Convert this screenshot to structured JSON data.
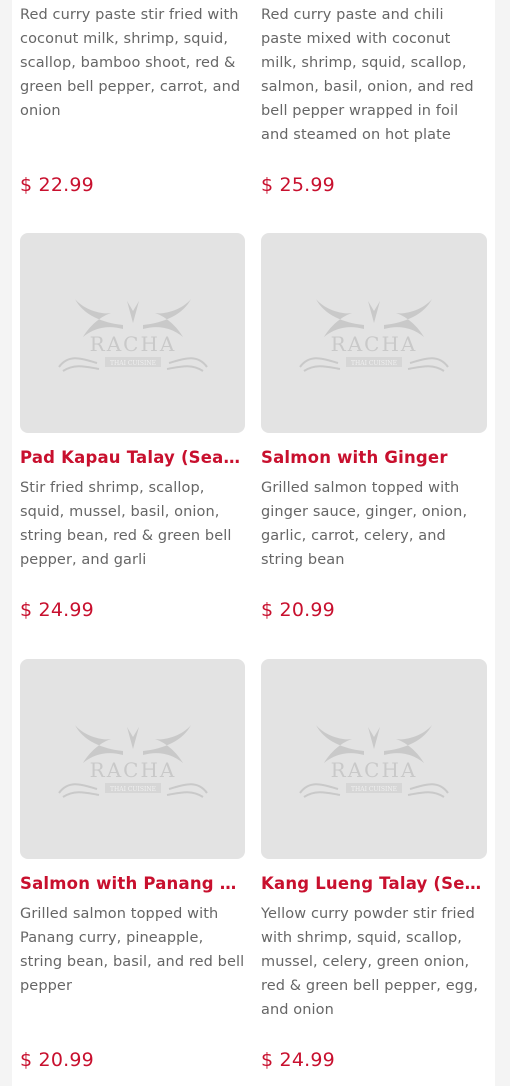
{
  "logo_text": "RACHA",
  "logo_subtext": "THAI CUISINE",
  "items": [
    {
      "title": "",
      "description": "Red curry paste stir fried with coconut milk, shrimp, squid, scallop, bamboo shoot, red & green bell pepper, carrot, and onion",
      "price": "$ 22.99"
    },
    {
      "title": "",
      "description": "Red curry paste and chili paste mixed with coconut milk, shrimp, squid, scallop, salmon, basil, onion, and red bell pepper wrapped in foil and steamed on hot plate",
      "price": "$ 25.99"
    },
    {
      "title": "Pad Kapau Talay (Seafo...",
      "description": "Stir fried shrimp, scallop, squid, mussel, basil, onion, string bean, red & green bell pepper, and garli",
      "price": "$ 24.99"
    },
    {
      "title": "Salmon with Ginger",
      "description": "Grilled salmon topped with ginger sauce, ginger, onion, garlic, carrot, celery, and string bean",
      "price": "$ 20.99"
    },
    {
      "title": "Salmon with Panang Cu...",
      "description": "Grilled salmon topped with Panang curry, pineapple, string bean, basil, and red bell pepper",
      "price": "$ 20.99"
    },
    {
      "title": "Kang Lueng Talay (Seaf...",
      "description": "Yellow curry powder stir fried with shrimp, squid, scallop, mussel, celery, green onion, red & green bell pepper, egg, and onion",
      "price": "$ 24.99"
    }
  ]
}
